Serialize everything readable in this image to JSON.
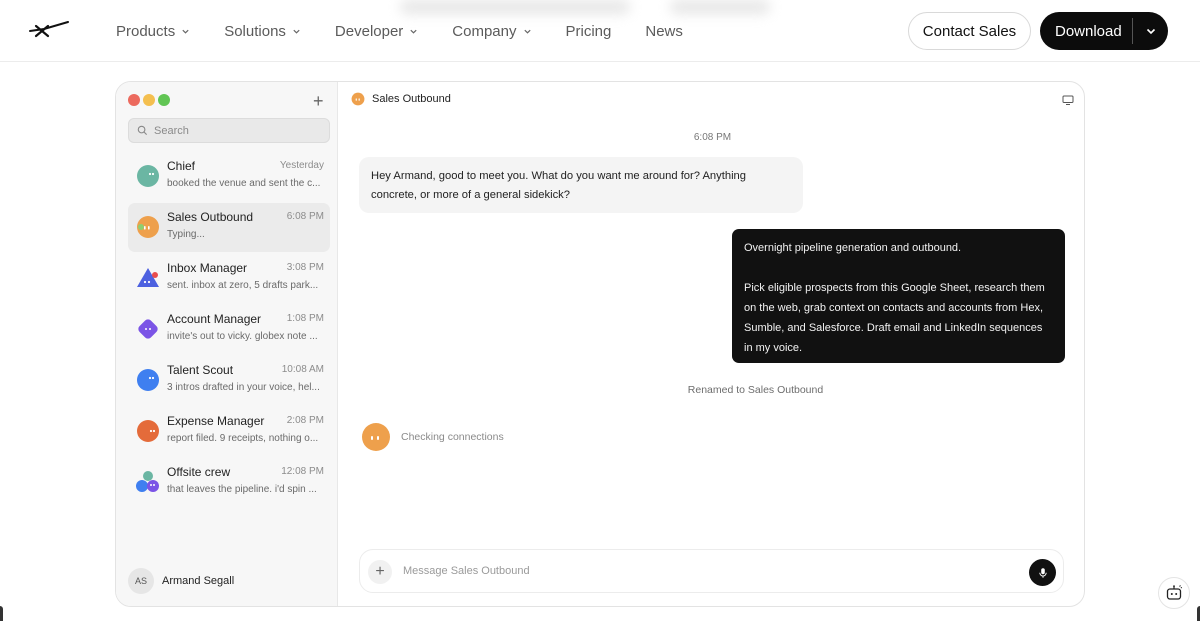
{
  "nav": {
    "items": [
      {
        "label": "Products",
        "dropdown": true
      },
      {
        "label": "Solutions",
        "dropdown": true
      },
      {
        "label": "Developer",
        "dropdown": true
      },
      {
        "label": "Company",
        "dropdown": true
      },
      {
        "label": "Pricing",
        "dropdown": false
      },
      {
        "label": "News",
        "dropdown": false
      }
    ],
    "contact_label": "Contact Sales",
    "download_label": "Download"
  },
  "sidebar": {
    "search_placeholder": "Search",
    "chats": [
      {
        "name": "Chief",
        "time": "Yesterday",
        "preview": "booked the venue and sent the c...",
        "avatar_color": "#6bb6a3"
      },
      {
        "name": "Sales Outbound",
        "time": "6:08 PM",
        "preview": "Typing...",
        "avatar_color": "#eea04c",
        "active": true
      },
      {
        "name": "Inbox Manager",
        "time": "3:08 PM",
        "preview": "sent. inbox at zero, 5 drafts park...",
        "avatar_color": "#4d61e0"
      },
      {
        "name": "Account Manager",
        "time": "1:08 PM",
        "preview": "invite's out to vicky. globex note ...",
        "avatar_color": "#7b54e6"
      },
      {
        "name": "Talent Scout",
        "time": "10:08 AM",
        "preview": "3 intros drafted in your voice, hel...",
        "avatar_color": "#3f7ff0"
      },
      {
        "name": "Expense Manager",
        "time": "2:08 PM",
        "preview": "report filed. 9 receipts, nothing o...",
        "avatar_color": "#e46b3a"
      },
      {
        "name": "Offsite crew",
        "time": "12:08 PM",
        "preview": "that leaves the pipeline. i'd spin ...",
        "avatar_color": "#5b4fdc"
      }
    ],
    "user": {
      "initials": "AS",
      "name": "Armand Segall"
    }
  },
  "conversation": {
    "title": "Sales Outbound",
    "timestamp": "6:08 PM",
    "incoming": "Hey Armand, good to meet you. What do you want me around for? Anything concrete, or more of a general sidekick?",
    "outgoing_line1": "Overnight pipeline generation and outbound.",
    "outgoing_line2": "Pick eligible prospects from this Google Sheet, research them on the web, grab context on contacts and accounts from Hex, Sumble, and Salesforce. Draft email and LinkedIn sequences in my voice.",
    "system": "Renamed to Sales Outbound",
    "status": "Checking connections",
    "composer_placeholder": "Message Sales Outbound"
  },
  "colors": {
    "traffic_red": "#ec6a5e",
    "traffic_yellow": "#f4bf4f",
    "traffic_green": "#61c554",
    "accent_dark": "#111111"
  }
}
